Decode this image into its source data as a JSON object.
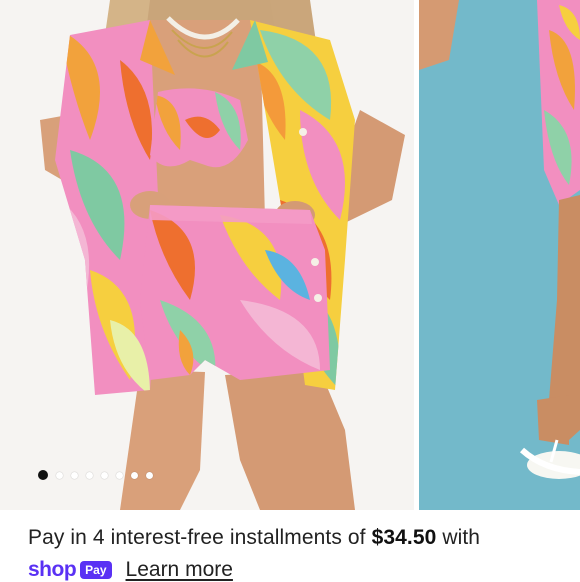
{
  "gallery": {
    "slide_count": 8,
    "active_index": 0,
    "main_image": "model-tropical-print-shirt-bikini-shorts",
    "next_image": "model-legs-white-flip-flops-blue-backdrop"
  },
  "installments": {
    "text_before": "Pay in 4 interest-free installments of ",
    "amount": "$34.50",
    "text_after": " with"
  },
  "shop_pay": {
    "shop_word": "shop",
    "pay_badge": "Pay",
    "learn_more": "Learn more"
  },
  "colors": {
    "shop_pay_purple": "#5a31f4",
    "backdrop_blue": "#73b9ca"
  }
}
